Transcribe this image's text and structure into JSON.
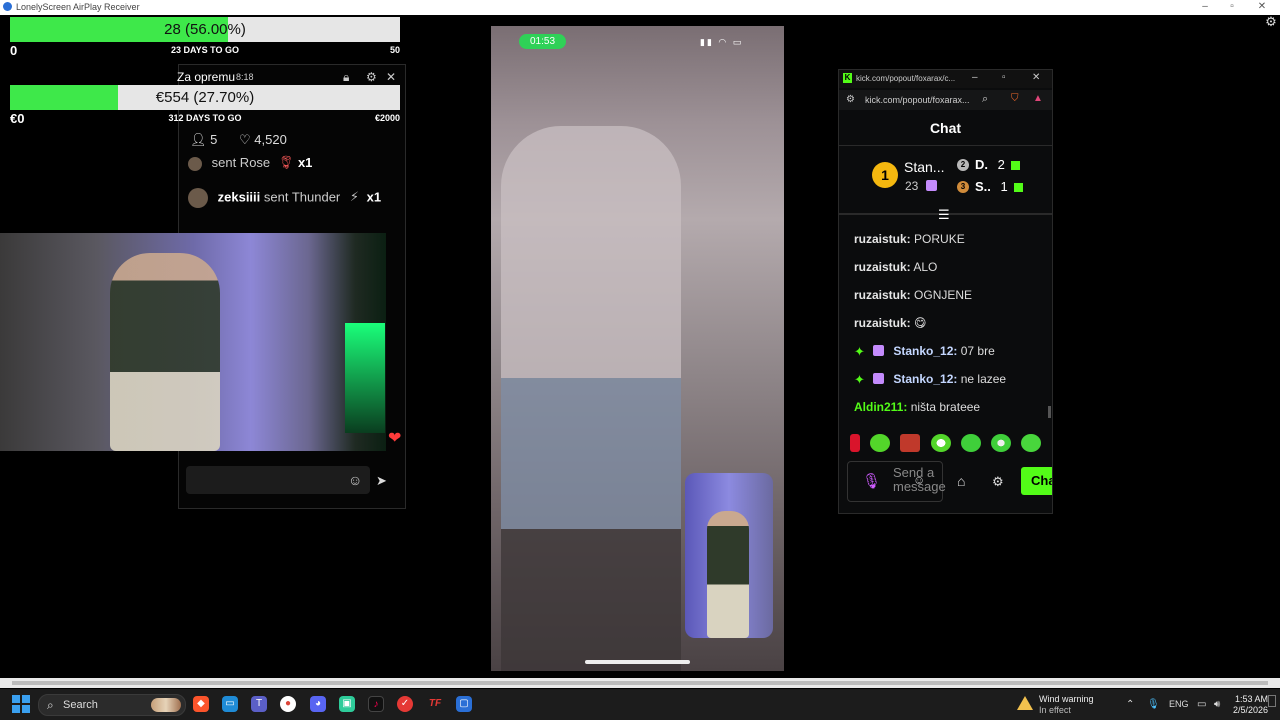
{
  "window": {
    "title": "LonelyScreen AirPlay Receiver"
  },
  "goals": [
    {
      "label": "28 (56.00%)",
      "start": "0",
      "days_left": "23 DAYS TO GO",
      "target": "50",
      "progress": 0.56,
      "color": "#3ee84a"
    },
    {
      "label": "€554 (27.70%)",
      "start": "€0",
      "days_left": "312 DAYS TO GO",
      "target": "€2000",
      "progress": 0.277,
      "color": "#3ee84a"
    }
  ],
  "tiktok": {
    "title": "Za opremu",
    "timer": "8:18",
    "viewers": "5",
    "likes": "4,520",
    "gifts": [
      {
        "text": "sent Rose",
        "count": "x1"
      },
      {
        "user": "zeksiiii",
        "text": "sent Thunder",
        "count": "x1"
      }
    ]
  },
  "phone": {
    "time": "01:53",
    "status_icons": "▮▮ ◠ ▭"
  },
  "kick": {
    "url_short": "kick.com/popout/foxarax/c...",
    "url": "kick.com/popout/foxarax...",
    "title": "Chat",
    "leaderboard": [
      {
        "rank": "1",
        "name": "Stan...",
        "count": "23"
      },
      {
        "rank": "2",
        "name": "D.",
        "count": "2"
      },
      {
        "rank": "3",
        "name": "S..",
        "count": "1"
      }
    ],
    "messages": [
      {
        "user": "ruzaistuk:",
        "text": "PORUKE",
        "color": "#e6e6e6"
      },
      {
        "user": "ruzaistuk:",
        "text": "ALO",
        "color": "#e6e6e6"
      },
      {
        "user": "ruzaistuk:",
        "text": "OGNJENE",
        "color": "#e6e6e6"
      },
      {
        "user": "ruzaistuk:",
        "text": "😋",
        "color": "#e6e6e6"
      },
      {
        "user": "Stanko_12:",
        "text": "07 bre",
        "color": "#c4d7ff"
      },
      {
        "user": "Stanko_12:",
        "text": "ne lazee",
        "color": "#c4d7ff"
      },
      {
        "user": "Aldin211:",
        "text": "ništa brateee",
        "color": "#53fc18"
      }
    ],
    "input_placeholder": "Send a message",
    "send_label": "Chat",
    "accent": "#53fc18"
  },
  "taskbar": {
    "search_label": "Search",
    "weather_title": "Wind warning",
    "weather_sub": "In effect",
    "lang": "ENG",
    "time": "1:53 AM",
    "date": "2/5/2026"
  }
}
